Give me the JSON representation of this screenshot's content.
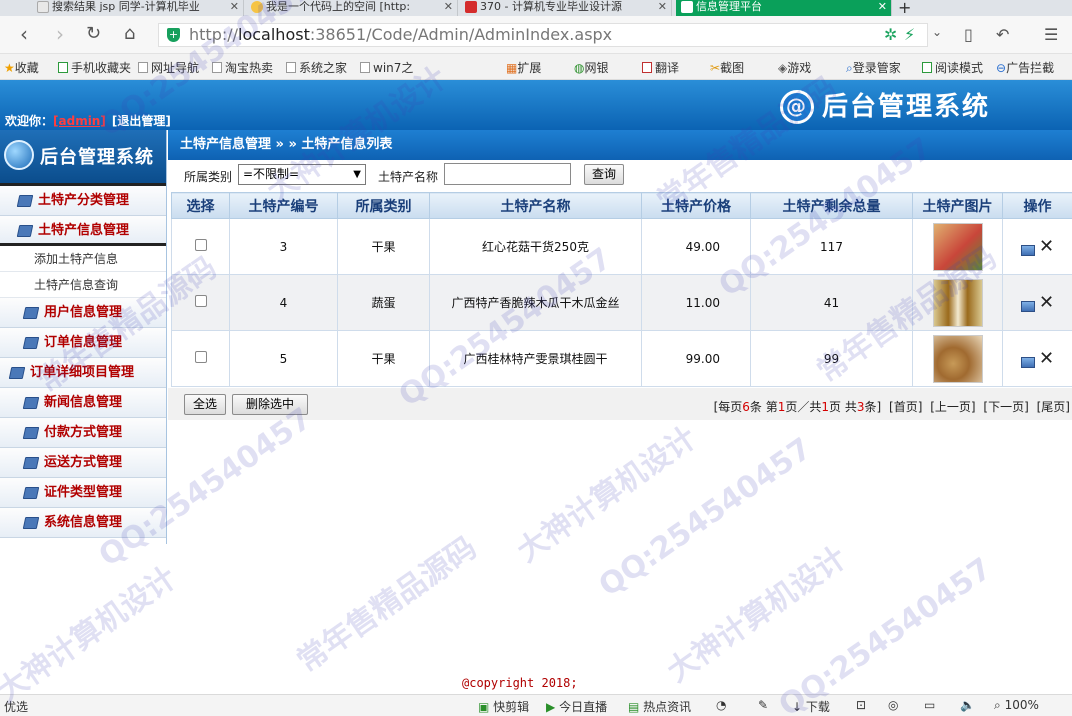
{
  "browser": {
    "tabs": [
      {
        "label": "搜索结果 jsp 同学-计算机毕业",
        "icon_color": "#e8e8e8"
      },
      {
        "label": "我是一个代码上的空间 [http:",
        "icon_color": "#f6c445"
      },
      {
        "label": "370 - 计算机专业毕业设计源",
        "icon_color": "#d42c2c"
      },
      {
        "label": "信息管理平台",
        "icon_color": "#ffffff"
      }
    ],
    "url_prefix": "http://",
    "url_host": "localhost",
    "url_rest": ":38651/Code/Admin/AdminIndex.aspx",
    "bookmarks": [
      "收藏",
      "手机收藏夹",
      "网址导航",
      "淘宝热卖",
      "系统之家",
      "win7之",
      "扩展",
      "网银",
      "翻译",
      "截图",
      "游戏",
      "登录管家",
      "阅读模式",
      "广告拦截"
    ]
  },
  "header": {
    "welcome": "欢迎你：",
    "username": "[admin]",
    "logout": "[退出管理]",
    "system_title": "后台管理系统",
    "logo_glyph": "@"
  },
  "sidebar": {
    "logo_text": "后台管理系统",
    "items": [
      {
        "label": "土特产分类管理"
      },
      {
        "label": "土特产信息管理"
      },
      {
        "label": "用户信息管理"
      },
      {
        "label": "订单信息管理"
      },
      {
        "label": "订单详细项目管理"
      },
      {
        "label": "新闻信息管理"
      },
      {
        "label": "付款方式管理"
      },
      {
        "label": "运送方式管理"
      },
      {
        "label": "证件类型管理"
      },
      {
        "label": "系统信息管理"
      }
    ],
    "sub_items": [
      "添加土特产信息",
      "土特产信息查询"
    ]
  },
  "breadcrumb": "土特产信息管理 » » 土特产信息列表",
  "filter": {
    "category_label": "所属类别",
    "category_value": "=不限制=",
    "name_label": "土特产名称",
    "name_value": "",
    "query_button": "查询"
  },
  "table": {
    "headers": [
      "选择",
      "土特产编号",
      "所属类别",
      "土特产名称",
      "土特产价格",
      "土特产剩余总量",
      "土特产图片",
      "操作"
    ],
    "rows": [
      {
        "id": "3",
        "category": "干果",
        "name": "红心花菇干货250克",
        "price": "49.00",
        "stock": "117",
        "thumb_color": "#c9463a"
      },
      {
        "id": "4",
        "category": "蔬蛋",
        "name": "广西特产香脆辣木瓜干木瓜金丝",
        "price": "11.00",
        "stock": "41",
        "thumb_color": "#9a6a1c"
      },
      {
        "id": "5",
        "category": "干果",
        "name": "广西桂林特产雯景琪桂圆干",
        "price": "99.00",
        "stock": "99",
        "thumb_color": "#c79a58"
      }
    ]
  },
  "actions": {
    "select_all": "全选",
    "delete_selected": "删除选中"
  },
  "pager": {
    "p1": "[每页",
    "per_page": "6",
    "p2": "条 第",
    "current": "1",
    "p3": "页／共",
    "total_pages": "1",
    "p4": "页 共",
    "total": "3",
    "p5": "条]",
    "first": "[首页]",
    "prev": "[上一页]",
    "next": "[下一页]",
    "last": "[尾页]"
  },
  "footer": {
    "copyright": "@copyright 2018;"
  },
  "statusbar": {
    "left": "优选",
    "items": [
      "快剪辑",
      "今日直播",
      "热点资讯",
      "下载",
      "100%"
    ]
  },
  "watermarks": [
    "QQ:254540457",
    "大神计算机设计",
    "常年售精品源码"
  ]
}
